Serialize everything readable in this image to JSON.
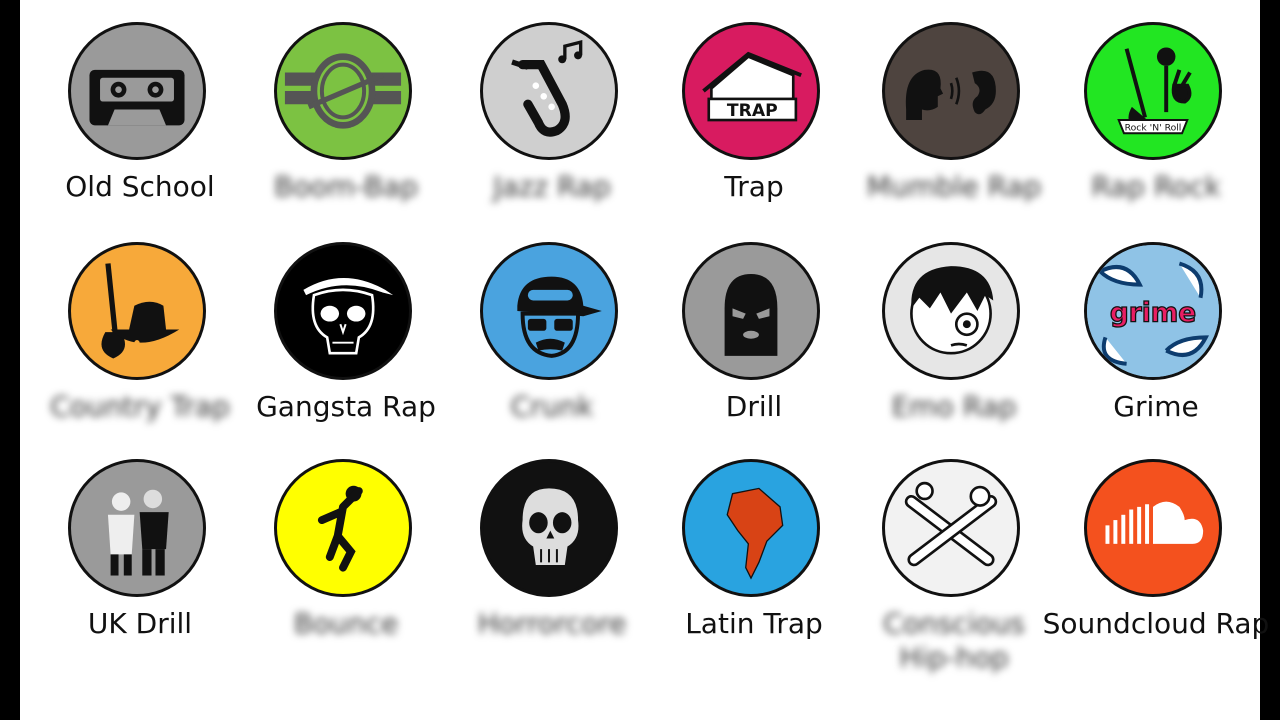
{
  "genres": [
    {
      "label": "Old School",
      "label_blurred": false,
      "icon": "cassette-icon",
      "bg": "#9a9a9a"
    },
    {
      "label": "Boom-Bap",
      "label_blurred": true,
      "icon": "drum-icon",
      "bg": "#7cc242"
    },
    {
      "label": "Jazz Rap",
      "label_blurred": true,
      "icon": "saxophone-icon",
      "bg": "#cfcfcf"
    },
    {
      "label": "Trap",
      "label_blurred": false,
      "icon": "trap-house-icon",
      "bg": "#d81b60"
    },
    {
      "label": "Mumble Rap",
      "label_blurred": true,
      "icon": "speak-ear-icon",
      "bg": "#4e443f"
    },
    {
      "label": "Rap Rock",
      "label_blurred": true,
      "icon": "rock-n-roll-icon",
      "bg": "#22e622"
    },
    {
      "label": "Country Trap",
      "label_blurred": true,
      "icon": "cowboy-guitar-icon",
      "bg": "#f7a93a"
    },
    {
      "label": "Gangsta Rap",
      "label_blurred": false,
      "icon": "bandana-skull-icon",
      "bg": "#000000"
    },
    {
      "label": "Crunk",
      "label_blurred": true,
      "icon": "cap-sunglasses-icon",
      "bg": "#4aa3df"
    },
    {
      "label": "Drill",
      "label_blurred": false,
      "icon": "balaclava-icon",
      "bg": "#9a9a9a"
    },
    {
      "label": "Emo Rap",
      "label_blurred": true,
      "icon": "emo-face-icon",
      "bg": "#e6e6e6"
    },
    {
      "label": "Grime",
      "label_blurred": false,
      "icon": "grime-graffiti-icon",
      "bg": "#8fc3e6"
    },
    {
      "label": "UK Drill",
      "label_blurred": false,
      "icon": "masked-duo-icon",
      "bg": "#9a9a9a"
    },
    {
      "label": "Bounce",
      "label_blurred": true,
      "icon": "bouncing-figure-icon",
      "bg": "#ffff00"
    },
    {
      "label": "Horrorcore",
      "label_blurred": true,
      "icon": "grunge-skull-icon",
      "bg": "#111111"
    },
    {
      "label": "Latin Trap",
      "label_blurred": false,
      "icon": "south-america-icon",
      "bg": "#29a3e0"
    },
    {
      "label": "Conscious Hip-hop",
      "label_blurred": true,
      "icon": "crossed-arms-icon",
      "bg": "#f2f2f2"
    },
    {
      "label": "Soundcloud Rap",
      "label_blurred": false,
      "icon": "soundcloud-icon",
      "bg": "#f4511e"
    }
  ],
  "badge_text": {
    "trap_sign": "TRAP",
    "rock_banner": "Rock 'N' Roll",
    "grime_tag": "grime"
  }
}
